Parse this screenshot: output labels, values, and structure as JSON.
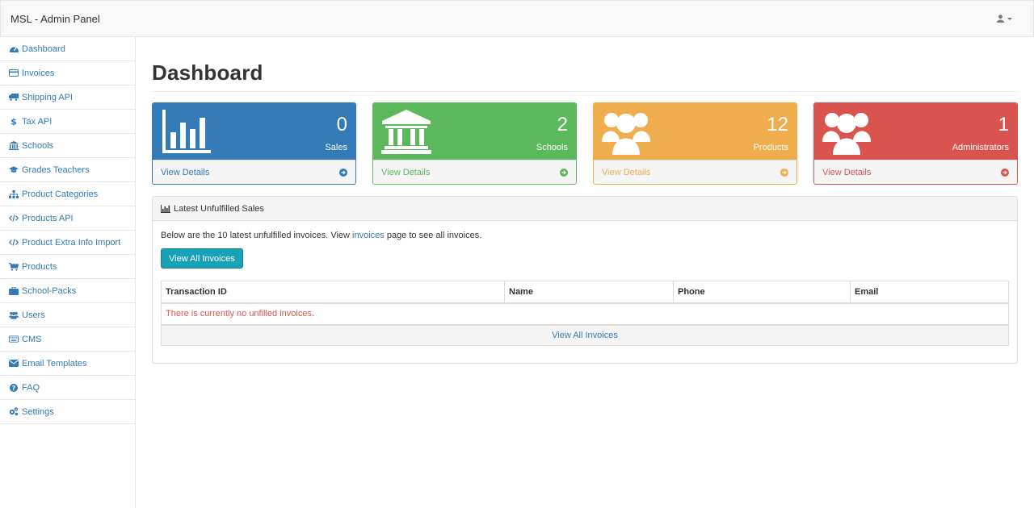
{
  "navbar": {
    "brand": "MSL - Admin Panel",
    "user_icon": "user-icon"
  },
  "sidebar": {
    "items": [
      {
        "label": "Dashboard",
        "icon": "dashboard-icon"
      },
      {
        "label": "Invoices",
        "icon": "credit-card-icon"
      },
      {
        "label": "Shipping API",
        "icon": "truck-icon"
      },
      {
        "label": "Tax API",
        "icon": "dollar-icon"
      },
      {
        "label": "Schools",
        "icon": "institution-icon"
      },
      {
        "label": "Grades Teachers",
        "icon": "graduation-cap-icon"
      },
      {
        "label": "Product Categories",
        "icon": "sitemap-icon"
      },
      {
        "label": "Products API",
        "icon": "code-icon"
      },
      {
        "label": "Product Extra Info Import",
        "icon": "code-icon"
      },
      {
        "label": "Products",
        "icon": "shopping-cart-icon"
      },
      {
        "label": "School-Packs",
        "icon": "briefcase-icon"
      },
      {
        "label": "Users",
        "icon": "users-icon"
      },
      {
        "label": "CMS",
        "icon": "keyboard-icon"
      },
      {
        "label": "Email Templates",
        "icon": "envelope-icon"
      },
      {
        "label": "FAQ",
        "icon": "question-circle-icon"
      },
      {
        "label": "Settings",
        "icon": "cogs-icon"
      }
    ]
  },
  "main": {
    "title": "Dashboard",
    "cards": [
      {
        "value": "0",
        "label": "Sales",
        "link": "View Details",
        "color": "#337ab7",
        "icon": "bar-chart-icon"
      },
      {
        "value": "2",
        "label": "Schools",
        "link": "View Details",
        "color": "#5cb85c",
        "icon": "institution-icon"
      },
      {
        "value": "12",
        "label": "Products",
        "link": "View Details",
        "color": "#f0ad4e",
        "icon": "users-icon"
      },
      {
        "value": "1",
        "label": "Administrators",
        "link": "View Details",
        "color": "#d9534f",
        "icon": "users-icon"
      }
    ],
    "panel": {
      "heading": "Latest Unfulfilled Sales",
      "intro_before": "Below are the 10 latest unfulfilled invoices. View ",
      "intro_link": "invoices",
      "intro_after": " page to see all invoices.",
      "button_label": "View All Invoices",
      "columns": [
        "Transaction ID",
        "Name",
        "Phone",
        "Email"
      ],
      "empty_message": "There is currently no unfilled invoices.",
      "footer_link": "View All Invoices"
    }
  }
}
